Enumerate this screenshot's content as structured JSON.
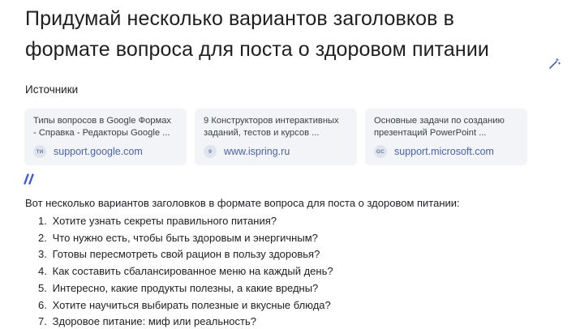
{
  "question": {
    "title": "Придумай несколько вариантов заголовков в формате вопроса для поста о здоровом питании"
  },
  "icons": {
    "edit": "magic-wand-icon",
    "quote": "quote-icon"
  },
  "sources": {
    "heading": "Источники",
    "items": [
      {
        "title": "Типы вопросов в Google Формах\n- Справка - Редакторы Google ...",
        "favicon": "TИ",
        "domain": "support.google.com"
      },
      {
        "title": "9 Конструкторов интерактивных\nзаданий, тестов и курсов ...",
        "favicon": "9",
        "domain": "www.ispring.ru"
      },
      {
        "title": "Основные задачи по созданию\nпрезентаций PowerPoint ...",
        "favicon": "OC",
        "domain": "support.microsoft.com"
      }
    ]
  },
  "answer": {
    "intro": "Вот несколько вариантов заголовков в формате вопроса для поста о здоровом питании:",
    "items": [
      {
        "num": "1.",
        "text": "Хотите узнать секреты правильного питания?"
      },
      {
        "num": "2.",
        "text": "Что нужно есть, чтобы быть здоровым и энергичным?"
      },
      {
        "num": "3.",
        "text": "Готовы пересмотреть свой рацион в пользу здоровья?"
      },
      {
        "num": "4.",
        "text": "Как составить сбалансированное меню на каждый день?"
      },
      {
        "num": "5.",
        "text": "Интересно, какие продукты полезны, а какие вредны?"
      },
      {
        "num": "6.",
        "text": "Хотите научиться выбирать полезные и вкусные блюда?"
      },
      {
        "num": "7.",
        "text": "Здоровое питание: миф или реальность?"
      }
    ]
  },
  "colors": {
    "card_bg": "#f2f4f7",
    "link": "#4a63a8",
    "accent": "#3b5bdb"
  }
}
